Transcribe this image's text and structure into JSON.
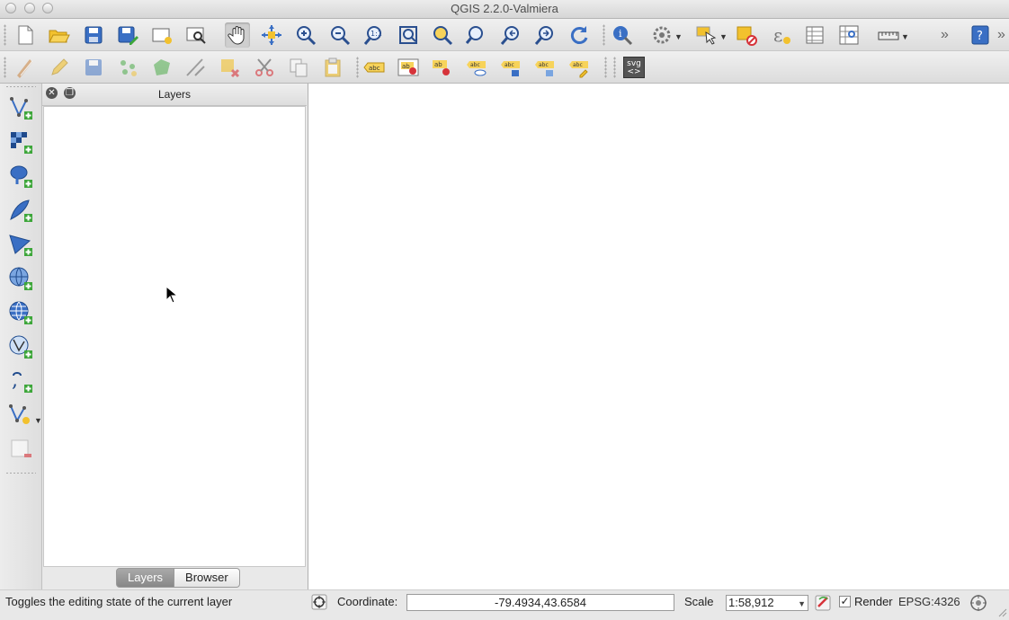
{
  "window": {
    "title": "QGIS 2.2.0-Valmiera"
  },
  "colors": {
    "accent_blue": "#3a6fc4",
    "icon_yellow": "#f2c12e",
    "icon_green": "#3da63a",
    "icon_red": "#d6333a"
  },
  "toolbar1": {
    "icons": [
      "new-project-icon",
      "open-project-icon",
      "save-project-icon",
      "save-as-icon",
      "new-print-composer-icon",
      "composer-manager-icon",
      "pan-icon",
      "pan-to-selection-icon",
      "zoom-in-icon",
      "zoom-out-icon",
      "zoom-actual-icon",
      "zoom-full-icon",
      "zoom-to-selection-icon",
      "zoom-to-layer-icon",
      "zoom-last-icon",
      "zoom-next-icon",
      "refresh-icon",
      "identify-icon",
      "action-icon",
      "select-icon",
      "deselect-icon",
      "field-calculator-icon",
      "attribute-table-icon",
      "statistics-icon",
      "measure-icon",
      "help-icon"
    ]
  },
  "toolbar2": {
    "icons": [
      "current-edits-icon",
      "toggle-editing-icon",
      "save-edits-icon",
      "add-feature-icon",
      "move-feature-icon",
      "node-tool-icon",
      "delete-selected-icon",
      "cut-features-icon",
      "copy-features-icon",
      "paste-features-icon",
      "label-icon",
      "layer-labeling-icon",
      "pin-labels-icon",
      "show-hide-labels-icon",
      "move-label-icon",
      "rotate-label-icon",
      "change-label-icon"
    ],
    "svg_button_label": "svg"
  },
  "left_toolbar": {
    "icons": [
      "add-vector-layer-icon",
      "add-raster-layer-icon",
      "add-postgis-layer-icon",
      "add-spatialite-layer-icon",
      "add-mssql-layer-icon",
      "add-wms-layer-icon",
      "add-wcs-layer-icon",
      "add-wfs-layer-icon",
      "add-delimited-text-icon",
      "new-shapefile-layer-icon",
      "remove-layer-icon"
    ]
  },
  "layers_panel": {
    "title": "Layers",
    "tabs": [
      {
        "label": "Layers",
        "active": true
      },
      {
        "label": "Browser",
        "active": false
      }
    ]
  },
  "statusbar": {
    "message": "Toggles the editing state of the current layer",
    "coordinate_label": "Coordinate:",
    "coordinate_value": "-79.4934,43.6584",
    "scale_label": "Scale",
    "scale_value": "1:58,912",
    "render_label": "Render",
    "render_checked": true,
    "crs_label": "EPSG:4326"
  }
}
